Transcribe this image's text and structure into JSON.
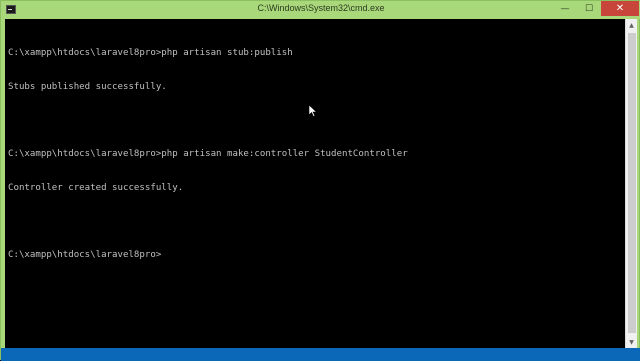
{
  "window": {
    "title": "C:\\Windows\\System32\\cmd.exe",
    "icon": "cmd-icon"
  },
  "controls": {
    "minimize": "—",
    "maximize": "☐",
    "close": "✕"
  },
  "console": {
    "lines": [
      "C:\\xampp\\htdocs\\laravel8pro>php artisan stub:publish",
      "Stubs published successfully.",
      "",
      "C:\\xampp\\htdocs\\laravel8pro>php artisan make:controller StudentController",
      "Controller created successfully.",
      "",
      "C:\\xampp\\htdocs\\laravel8pro>"
    ]
  },
  "scrollbar": {
    "up": "▲",
    "down": "▼"
  },
  "colors": {
    "titlebar": "#a8d879",
    "close": "#c7453a",
    "console_bg": "#000000",
    "console_text": "#c0c0c0",
    "taskbar_strip": "#0b68b8"
  }
}
